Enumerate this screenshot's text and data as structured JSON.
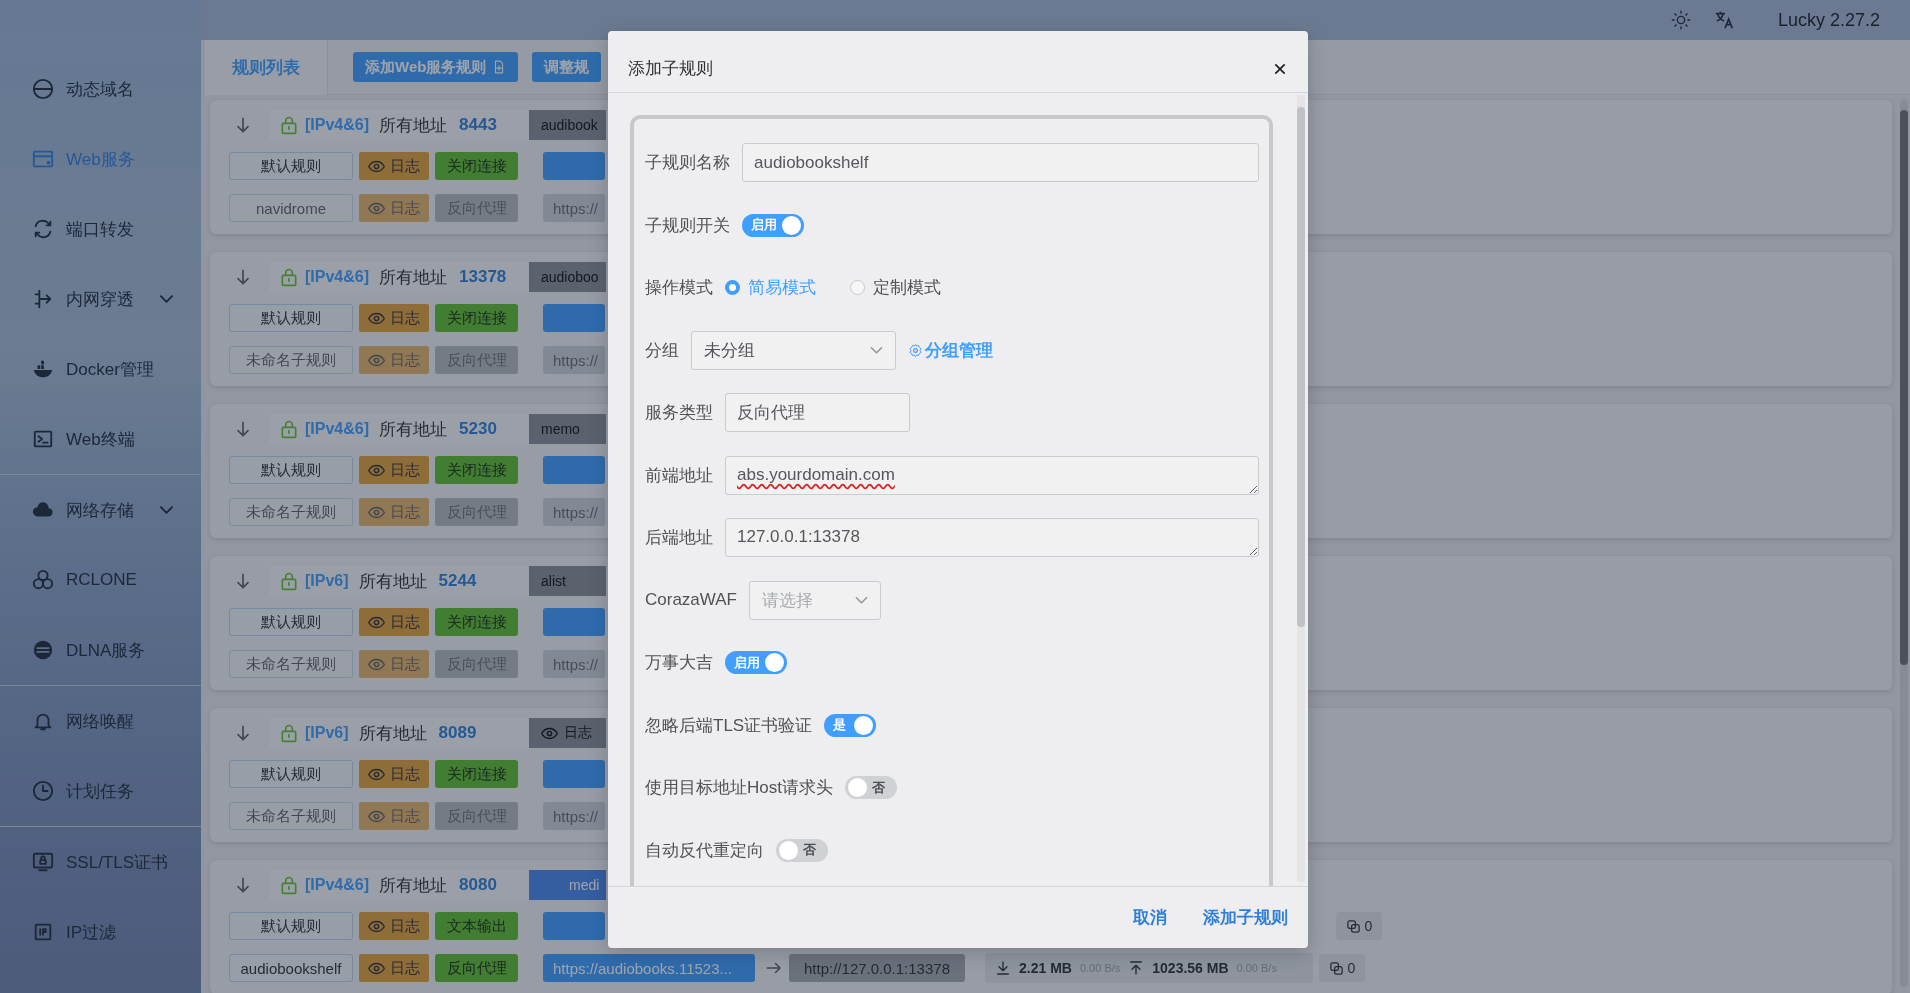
{
  "topbar": {
    "version": "Lucky 2.27.2"
  },
  "sidebar": {
    "items": [
      {
        "label": "动态域名",
        "selected": false,
        "expandable": false
      },
      {
        "label": "Web服务",
        "selected": true,
        "expandable": false
      },
      {
        "label": "端口转发",
        "selected": false,
        "expandable": false
      },
      {
        "label": "内网穿透",
        "selected": false,
        "expandable": true
      },
      {
        "label": "Docker管理",
        "selected": false,
        "expandable": false
      },
      {
        "label": "Web终端",
        "selected": false,
        "expandable": false
      },
      {
        "label": "网络存储",
        "selected": false,
        "expandable": true
      },
      {
        "label": "RCLONE",
        "selected": false,
        "expandable": false
      },
      {
        "label": "DLNA服务",
        "selected": false,
        "expandable": false
      },
      {
        "label": "网络唤醒",
        "selected": false,
        "expandable": false
      },
      {
        "label": "计划任务",
        "selected": false,
        "expandable": false
      },
      {
        "label": "SSL/TLS证书",
        "selected": false,
        "expandable": false
      },
      {
        "label": "IP过滤",
        "selected": false,
        "expandable": false
      }
    ]
  },
  "tabs": [
    {
      "label": "规则列表",
      "selected": true
    }
  ],
  "toolbar_buttons": [
    "添加Web服务规则",
    "调整规"
  ],
  "cards": [
    {
      "ip": "[IPv4&6]",
      "address": "所有地址",
      "port": "8443",
      "service": {
        "kind": "name",
        "text": "audibook"
      },
      "rows": [
        {
          "name": "默认规则",
          "enabled": true,
          "log": "日志",
          "action": "关闭连接"
        },
        {
          "name": "navidrome",
          "enabled": false,
          "log": "日志",
          "action": "反向代理",
          "link": "https://"
        }
      ]
    },
    {
      "ip": "[IPv4&6]",
      "address": "所有地址",
      "port": "13378",
      "service": {
        "kind": "name",
        "text": "audioboo"
      },
      "rows": [
        {
          "name": "默认规则",
          "enabled": true,
          "log": "日志",
          "action": "关闭连接"
        },
        {
          "name": "未命名子规则",
          "enabled": false,
          "log": "日志",
          "action": "反向代理",
          "link": "https://"
        }
      ]
    },
    {
      "ip": "[IPv4&6]",
      "address": "所有地址",
      "port": "5230",
      "service": {
        "kind": "name",
        "text": "memo"
      },
      "rows": [
        {
          "name": "默认规则",
          "enabled": true,
          "log": "日志",
          "action": "关闭连接"
        },
        {
          "name": "未命名子规则",
          "enabled": false,
          "log": "日志",
          "action": "反向代理",
          "link": "https://"
        }
      ]
    },
    {
      "ip": "[IPv6]",
      "address": "所有地址",
      "port": "5244",
      "service": {
        "kind": "name",
        "text": "alist"
      },
      "rows": [
        {
          "name": "默认规则",
          "enabled": true,
          "log": "日志",
          "action": "关闭连接"
        },
        {
          "name": "未命名子规则",
          "enabled": false,
          "log": "日志",
          "action": "反向代理",
          "link": "https://"
        }
      ]
    },
    {
      "ip": "[IPv6]",
      "address": "所有地址",
      "port": "8089",
      "service": {
        "kind": "log",
        "text": "日志"
      },
      "rows": [
        {
          "name": "默认规则",
          "enabled": true,
          "log": "日志",
          "action": "关闭连接"
        },
        {
          "name": "未命名子规则",
          "enabled": false,
          "log": "日志",
          "action": "反向代理",
          "link": "https://"
        }
      ]
    },
    {
      "ip": "[IPv4&6]",
      "address": "所有地址",
      "port": "8080",
      "service": {
        "kind": "highlight",
        "text": "medi"
      },
      "rows": [
        {
          "name": "默认规则",
          "enabled": true,
          "log": "日志",
          "action": "文本输出",
          "connections": "0"
        },
        {
          "name": "audiobookshelf",
          "enabled": true,
          "log": "日志",
          "action": "反向代理",
          "link": "https://audiobooks.11523...",
          "target": "http://127.0.0.1:13378",
          "stats": {
            "down": "2.21 MB",
            "down_rate": "0.00 B/s",
            "up": "1023.56 MB",
            "up_rate": "0.00 B/s"
          },
          "connections": "0"
        }
      ]
    }
  ],
  "dialog": {
    "title": "添加子规则",
    "fields": [
      {
        "kind": "text",
        "label": "子规则名称",
        "value": "audiobookshelf"
      },
      {
        "kind": "switch",
        "label": "子规则开关",
        "on": true,
        "text": "启用"
      },
      {
        "kind": "radio",
        "label": "操作模式",
        "options": [
          {
            "label": "简易模式",
            "selected": true
          },
          {
            "label": "定制模式",
            "selected": false
          }
        ]
      },
      {
        "kind": "select",
        "label": "分组",
        "value": "未分组",
        "link": "分组管理"
      },
      {
        "kind": "readonly",
        "label": "服务类型",
        "value": "反向代理"
      },
      {
        "kind": "textarea",
        "label": "前端地址",
        "value": "abs.yourdomain.com",
        "misspelled": true
      },
      {
        "kind": "textarea",
        "label": "后端地址",
        "value": "127.0.0.1:13378",
        "misspelled": false
      },
      {
        "kind": "select",
        "label": "CorazaWAF",
        "placeholder": "请选择"
      },
      {
        "kind": "switch",
        "label": "万事大吉",
        "on": true,
        "text": "启用"
      },
      {
        "kind": "switch",
        "label": "忽略后端TLS证书验证",
        "on": true,
        "text": "是"
      },
      {
        "kind": "switch",
        "label": "使用目标地址Host请求头",
        "on": false,
        "text": "否"
      },
      {
        "kind": "switch",
        "label": "自动反代重定向",
        "on": false,
        "text": "否"
      }
    ],
    "buttons": [
      {
        "label": "取消"
      },
      {
        "label": "添加子规则"
      }
    ]
  }
}
